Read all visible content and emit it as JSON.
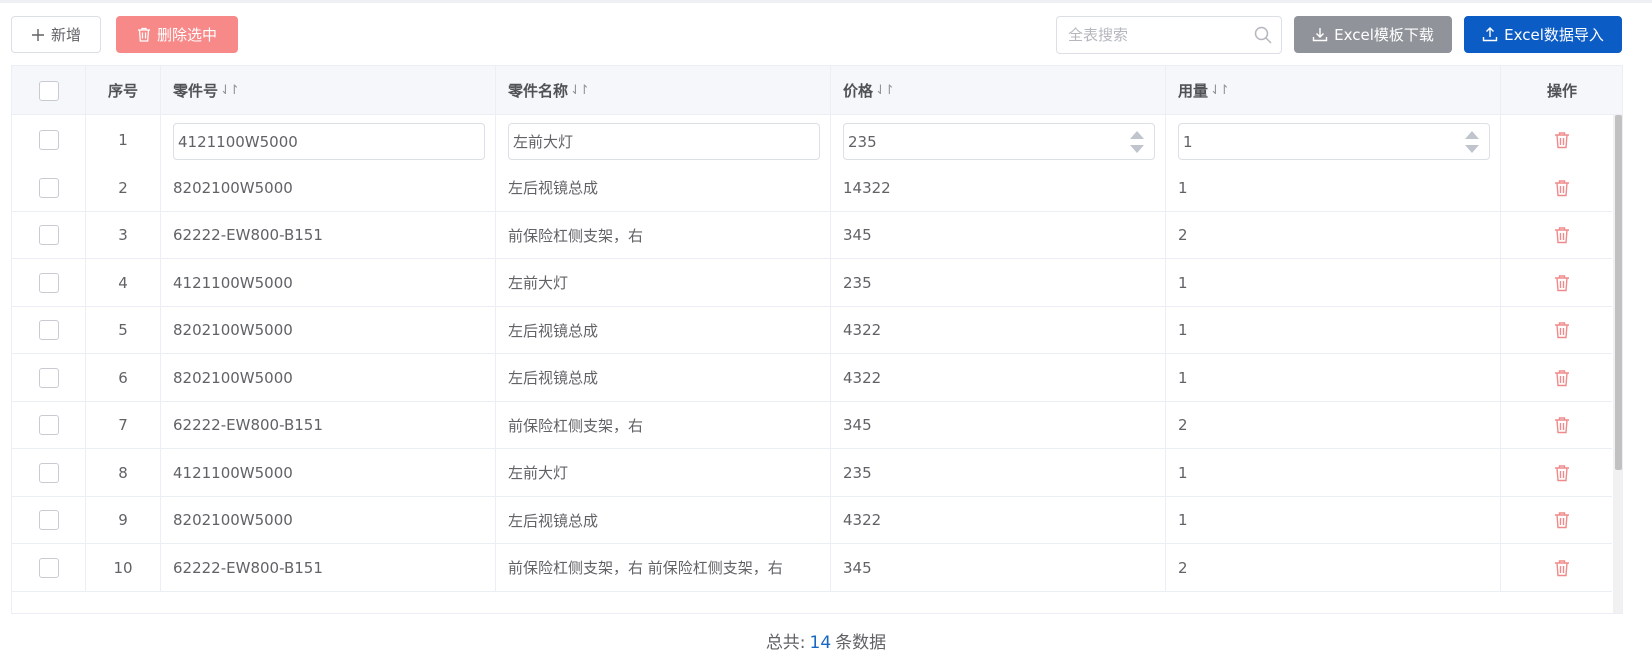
{
  "toolbar": {
    "add_label": "新增",
    "delete_label": "删除选中",
    "search_placeholder": "全表搜索",
    "template_label": "Excel模板下载",
    "import_label": "Excel数据导入"
  },
  "colors": {
    "primary": "#0b5cc5",
    "danger": "#f78989",
    "info": "#909399",
    "delete_icon": "#f08a8a"
  },
  "table": {
    "headers": {
      "index": "序号",
      "part_no": "零件号",
      "part_name": "零件名称",
      "price": "价格",
      "usage": "用量",
      "action": "操作"
    },
    "sort_symbol": "⇃↾",
    "editing_row": {
      "index": "1",
      "part_no": "4121100W5000",
      "part_name": "左前大灯",
      "price": "235",
      "usage": "1"
    },
    "rows": [
      {
        "index": "2",
        "part_no": "8202100W5000",
        "part_name": "左后视镜总成",
        "price": "14322",
        "usage": "1"
      },
      {
        "index": "3",
        "part_no": "62222-EW800-B151",
        "part_name": "前保险杠侧支架，右",
        "price": "345",
        "usage": "2"
      },
      {
        "index": "4",
        "part_no": "4121100W5000",
        "part_name": "左前大灯",
        "price": "235",
        "usage": "1"
      },
      {
        "index": "5",
        "part_no": "8202100W5000",
        "part_name": "左后视镜总成",
        "price": "4322",
        "usage": "1"
      },
      {
        "index": "6",
        "part_no": "8202100W5000",
        "part_name": "左后视镜总成",
        "price": "4322",
        "usage": "1"
      },
      {
        "index": "7",
        "part_no": "62222-EW800-B151",
        "part_name": "前保险杠侧支架，右",
        "price": "345",
        "usage": "2"
      },
      {
        "index": "8",
        "part_no": "4121100W5000",
        "part_name": "左前大灯",
        "price": "235",
        "usage": "1"
      },
      {
        "index": "9",
        "part_no": "8202100W5000",
        "part_name": "左后视镜总成",
        "price": "4322",
        "usage": "1"
      },
      {
        "index": "10",
        "part_no": "62222-EW800-B151",
        "part_name": "前保险杠侧支架，右 前保险杠侧支架，右",
        "price": "345",
        "usage": "2"
      }
    ]
  },
  "footer": {
    "prefix": "总共:",
    "total": "14",
    "suffix": "条数据"
  }
}
